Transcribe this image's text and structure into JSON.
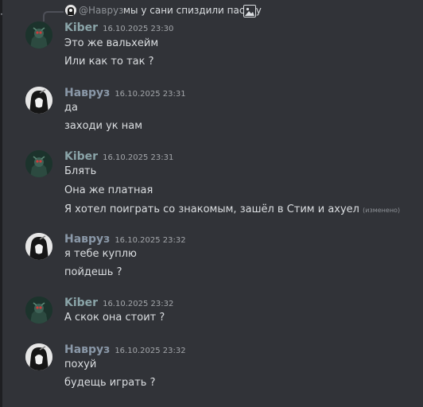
{
  "reply": {
    "author": "@Навруз",
    "text": "мы у сани спиздили паську"
  },
  "messages": [
    {
      "author": "Kiber",
      "time": "16.10.2025 23:30",
      "lines": [
        "Это же вальхейм",
        "Или как то так ?"
      ]
    },
    {
      "author": "Навруз",
      "time": "16.10.2025 23:31",
      "lines": [
        "да",
        "заходи ук нам"
      ]
    },
    {
      "author": "Kiber",
      "time": "16.10.2025 23:31",
      "lines": [
        "Блять",
        "Она же платная",
        "Я хотел поиграть со знакомым, зашёл в Стим и ахуел"
      ],
      "edited": "(изменено)"
    },
    {
      "author": "Навруз",
      "time": "16.10.2025 23:32",
      "lines": [
        "я тебе куплю",
        "пойдешь ?"
      ]
    },
    {
      "author": "Kiber",
      "time": "16.10.2025 23:32",
      "lines": [
        "А скок она стоит ?"
      ]
    },
    {
      "author": "Навруз",
      "time": "16.10.2025 23:32",
      "lines": [
        "похуй",
        "будещь играть ?"
      ]
    }
  ],
  "icons": {
    "reply": "reply-spine-icon",
    "attachment": "image-attachment-icon",
    "avatar_kiber": "kiber-avatar",
    "avatar_navruz": "navruz-avatar"
  },
  "colors": {
    "background": "#313338",
    "text": "#dbdee1",
    "kiber_name": "#8aa4a8",
    "navruz_name": "#8a98a8",
    "timestamp": "#a3a6aa"
  }
}
